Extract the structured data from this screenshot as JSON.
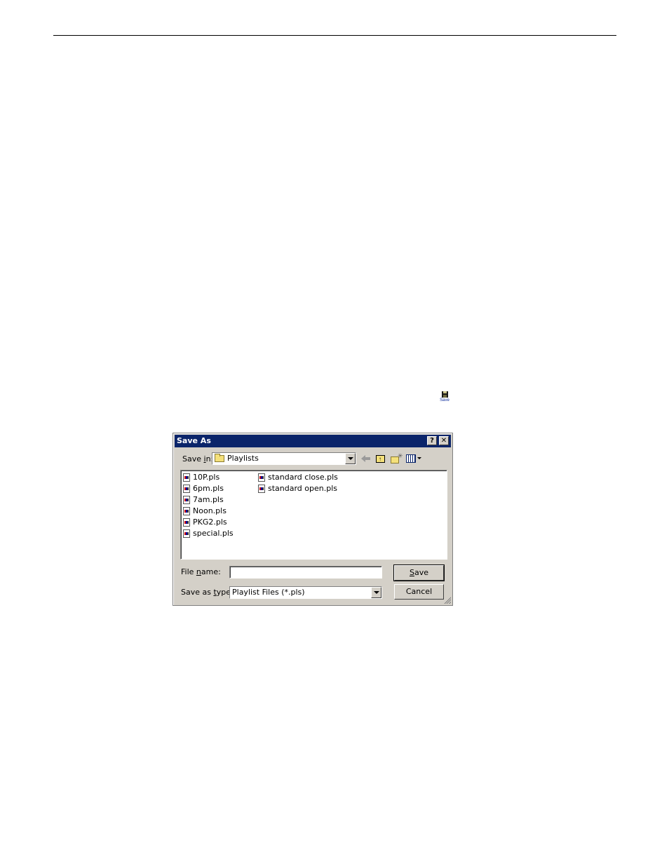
{
  "toolbar_icon": {
    "label": "Save",
    "icon": "floppy-disk-icon"
  },
  "dialog": {
    "title": "Save As",
    "title_buttons": {
      "help": "?",
      "close": "✕"
    },
    "save_in": {
      "label_prefix": "Save ",
      "label_accel": "i",
      "label_suffix": "n:",
      "value": "Playlists"
    },
    "toolbar": [
      "back-icon",
      "up-one-level-icon",
      "new-folder-icon",
      "views-menu-icon"
    ],
    "files": [
      {
        "name": "10P.pls"
      },
      {
        "name": "6pm.pls"
      },
      {
        "name": "7am.pls"
      },
      {
        "name": "Noon.pls"
      },
      {
        "name": "PKG2.pls"
      },
      {
        "name": "special.pls"
      },
      {
        "name": "standard close.pls"
      },
      {
        "name": "standard open.pls"
      }
    ],
    "file_name": {
      "label_prefix": "File ",
      "label_accel": "n",
      "label_suffix": "ame:",
      "value": "",
      "placeholder": ""
    },
    "save_as_type": {
      "label_prefix": "Save as ",
      "label_accel": "t",
      "label_suffix": "ype:",
      "value": "Playlist Files (*.pls)"
    },
    "buttons": {
      "save": {
        "accel": "S",
        "rest": "ave"
      },
      "cancel": "Cancel"
    }
  }
}
